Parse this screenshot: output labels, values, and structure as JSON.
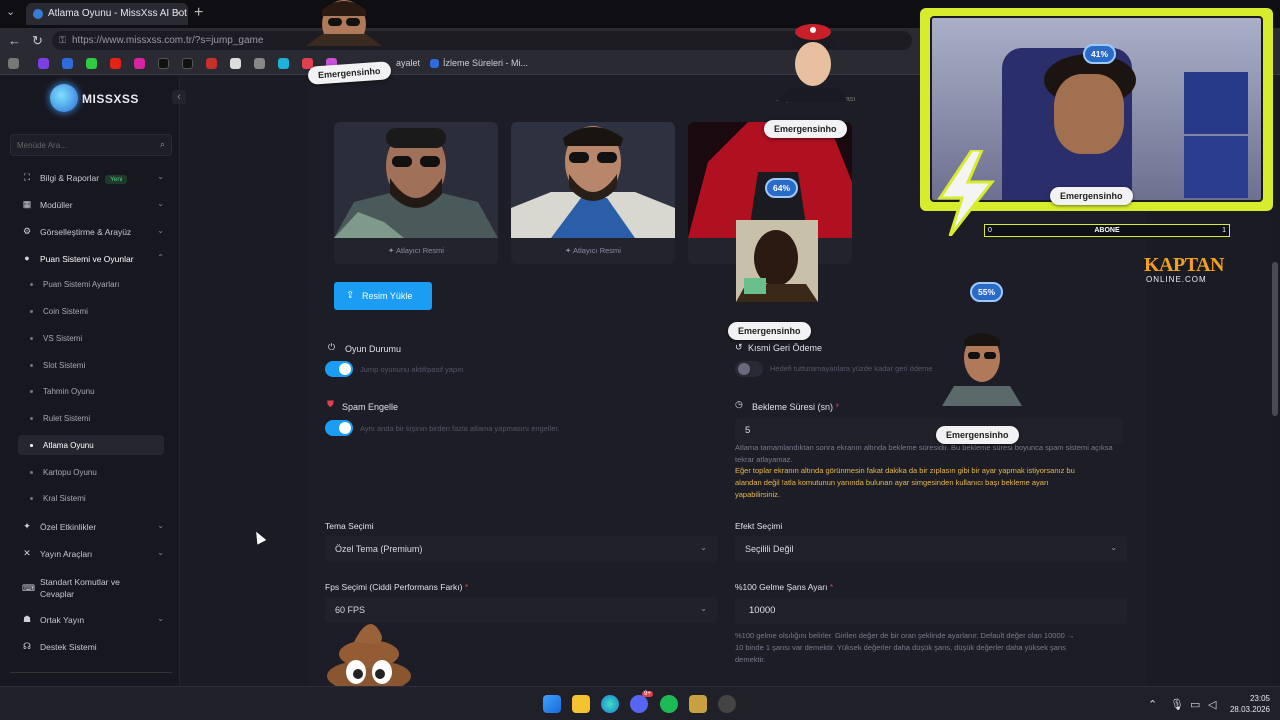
{
  "browser": {
    "tab_title": "Atlama Oyunu - MissXss AI Bot Sy",
    "url": "https://www.missxss.com.tr/?s=jump_game",
    "bookmarks": [
      "İzleme Süreleri - Mi..."
    ],
    "bookmark_partial": "ayalet"
  },
  "sidebar": {
    "brand": "MISSXSS",
    "search_placeholder": "Menüde Ara...",
    "items": [
      {
        "label": "Bilgi & Raporlar",
        "badge": "Yeni",
        "icon": "chart-icon"
      },
      {
        "label": "Modüller",
        "icon": "grid-icon"
      },
      {
        "label": "Görselleştirme & Arayüz",
        "icon": "gear-icon"
      },
      {
        "label": "Puan Sistemi ve Oyunlar",
        "icon": "gamepad-icon"
      }
    ],
    "subitems": [
      "Puan Sistemi Ayarları",
      "Coin Sistemi",
      "VS Sistemi",
      "Slot Sistemi",
      "Tahmin Oyunu",
      "Rulet Sistemi",
      "Atlama Oyunu",
      "Kartopu Oyunu",
      "Kral Sistemi"
    ],
    "items_after": [
      {
        "label": "Özel Etkinlikler",
        "icon": "gift-icon"
      },
      {
        "label": "Yayın Araçları",
        "icon": "tools-icon"
      },
      {
        "label": "Standart Komutlar ve Cevaplar",
        "icon": "keyboard-icon"
      },
      {
        "label": "Ortak Yayın",
        "icon": "users-icon"
      },
      {
        "label": "Destek Sistemi",
        "icon": "headset-icon"
      }
    ]
  },
  "main": {
    "top_note": "...ayarlarını etkin olması",
    "card_label": "Atlayıcı Resmi",
    "upload_button": "Resim Yükle",
    "game_status": {
      "label": "Oyun Durumu",
      "desc": "Jump oyununu aktif/pasif yapın"
    },
    "partial_refund": {
      "label": "Kısmi Geri Ödeme",
      "desc": "Hedefi tutturamayanlara yüzde kadar geri ödeme"
    },
    "spam": {
      "label": "Spam Engelle",
      "desc": "Aynı anda bir kişinin birden fazla atlama yapmasını engeller."
    },
    "wait": {
      "label": "Bekleme Süresi (sn)",
      "value": "5",
      "help": "Atlama tamamlandıktan sonra ekranın altında bekleme süresidir. Bu bekleme süresi boyunca spam sistemi açıksa tekrar atlayamaz.",
      "warn_line1": "Eğer toplar ekranın altında görünmesin fakat dakika da bir zıplasın gibi bir ayar yapmak istiyorsanız bu",
      "warn_line2": "alandan değil !atla komutunun yanında bulunan ayar simgesinden kullanıcı başı bekleme ayarı",
      "warn_line3": "yapabilirsiniz."
    },
    "theme": {
      "label": "Tema Seçimi",
      "value": "Özel Tema (Premium)"
    },
    "effect": {
      "label": "Efekt Seçimi",
      "value": "Seçilili Değil"
    },
    "fps": {
      "label": "Fps Seçimi (Ciddi Performans Farkı)",
      "value": "60 FPS"
    },
    "chance": {
      "label": "%100 Gelme Şans Ayarı",
      "value": "10000",
      "help1": "%100 gelme olsılığını belirler. Girilen değer de bir oran şeklinde ayarlanır. Default değer olan 10000 →",
      "help2": "10 binde 1 şansı var demektir. Yüksek değerler daha düşük şans, düşük değerler daha yüksek şans",
      "help3": "demektir."
    }
  },
  "overlay": {
    "nametag": "Emergensinho",
    "percents": [
      "41%",
      "64%",
      "55%"
    ],
    "abone": {
      "left": "0",
      "center": "ABONE",
      "right": "1"
    },
    "kaptan_line1": "KAPTAN",
    "kaptan_line2": "ONLINE.COM"
  },
  "taskbar": {
    "time": "23:05",
    "date": "28.03.2026",
    "badge": "9+"
  },
  "colors": {
    "accent": "#1a9df2",
    "warn": "#e8b84a",
    "webcam_frame": "#d8ec2e",
    "required": "#e04050"
  }
}
